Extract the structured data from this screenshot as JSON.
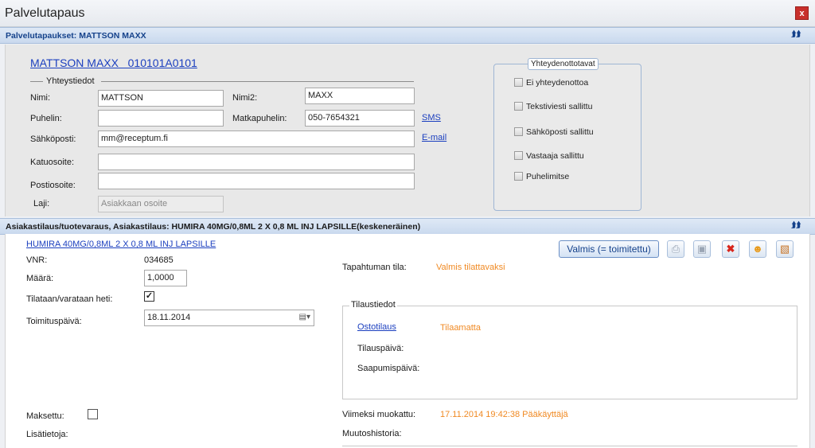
{
  "window": {
    "title": "Palvelutapaus",
    "close_label": "x"
  },
  "section1": {
    "header": "Palvelutapaukset: MATTSON MAXX",
    "customer_link": "MATTSON MAXX   010101A0101",
    "group_title": "Yhteystiedot",
    "fields": {
      "nimi_label": "Nimi:",
      "nimi_value": "MATTSON",
      "nimi2_label": "Nimi2:",
      "nimi2_value": "MAXX",
      "puhelin_label": "Puhelin:",
      "puhelin_value": "",
      "matkapuhelin_label": "Matkapuhelin:",
      "matkapuhelin_value": "050-7654321",
      "sms_link": "SMS",
      "sahkoposti_label": "Sähköposti:",
      "sahkoposti_value": "mm@receptum.fi",
      "email_link": "E-mail",
      "katuosoite_label": "Katuosoite:",
      "katuosoite_value": "",
      "postiosoite_label": "Postiosoite:",
      "postiosoite_value": "",
      "laji_label": "Laji:",
      "laji_value": "Asiakkaan osoite"
    },
    "contact_methods": {
      "title": "Yhteydenottotavat",
      "options": [
        {
          "label": "Ei yhteydenottoa",
          "checked": false
        },
        {
          "label": "Tekstiviesti sallittu",
          "checked": false
        },
        {
          "label": "Sähköposti sallittu",
          "checked": false
        },
        {
          "label": "Vastaaja sallittu",
          "checked": false
        },
        {
          "label": "Puhelimitse",
          "checked": false
        }
      ]
    }
  },
  "section2": {
    "header": "Asiakastilaus/tuotevaraus, Asiakastilaus:  HUMIRA 40MG/0,8ML 2 X 0,8 ML INJ LAPSILLE(keskeneräinen)",
    "product_link": "HUMIRA 40MG/0,8ML 2 X 0,8 ML INJ LAPSILLE",
    "vnr_label": "VNR:",
    "vnr_value": "034685",
    "maara_label": "Määrä:",
    "maara_value": "1,0000",
    "tilataan_label": "Tilataan/varataan heti:",
    "tilataan_checked": true,
    "toimituspaiva_label": "Toimituspäivä:",
    "toimituspaiva_value": "18.11.2014",
    "tapahtuman_tila_label": "Tapahtuman tila:",
    "tapahtuman_tila_value": "Valmis tilattavaksi",
    "valmis_button": "Valmis (= toimitettu)",
    "tilaustiedot": {
      "title": "Tilaustiedot",
      "ostotilaus_link": "Ostotilaus",
      "ostotilaus_status": "Tilaamatta",
      "tilauspaiva_label": "Tilauspäivä:",
      "saapumispaiva_label": "Saapumispäivä:"
    },
    "maksettu_label": "Maksettu:",
    "maksettu_checked": false,
    "lisatietoja_label": "Lisätietoja:",
    "viimeksi_label": "Viimeksi muokattu:",
    "viimeksi_value": "17.11.2014 19:42:38 Pääkäyttäjä",
    "muutoshistoria_label": "Muutoshistoria:"
  },
  "colors": {
    "accent": "#15428b",
    "status": "#f08a24",
    "link": "#1b3fbf"
  }
}
